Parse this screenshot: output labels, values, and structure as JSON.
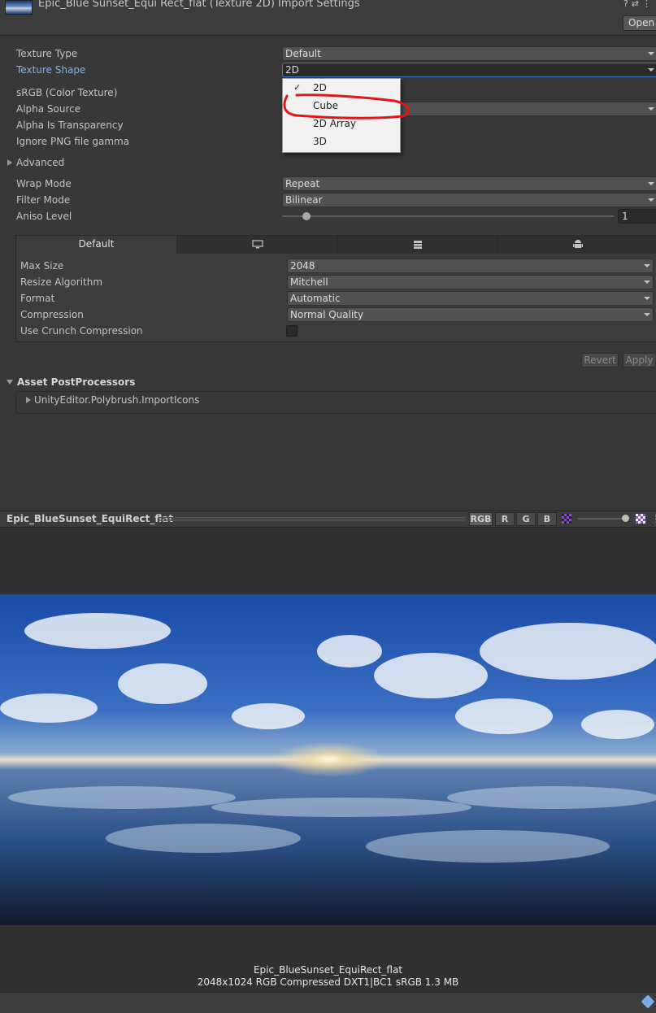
{
  "header": {
    "title": "Epic_Blue Sunset_Equi Rect_flat (Texture 2D) Import Settings",
    "open_label": "Open",
    "icons": [
      "help-icon",
      "preset-icon",
      "menu-icon"
    ]
  },
  "fields": {
    "texture_type": {
      "label": "Texture Type",
      "value": "Default"
    },
    "texture_shape": {
      "label": "Texture Shape",
      "value": "2D"
    },
    "srgb": {
      "label": "sRGB (Color Texture)"
    },
    "alpha_source": {
      "label": "Alpha Source"
    },
    "alpha_transparency": {
      "label": "Alpha Is Transparency"
    },
    "ignore_png_gamma": {
      "label": "Ignore PNG file gamma"
    },
    "advanced": {
      "label": "Advanced"
    },
    "wrap_mode": {
      "label": "Wrap Mode",
      "value": "Repeat"
    },
    "filter_mode": {
      "label": "Filter Mode",
      "value": "Bilinear"
    },
    "aniso_level": {
      "label": "Aniso Level",
      "value": "1"
    }
  },
  "shape_menu": {
    "options": [
      "2D",
      "Cube",
      "2D Array",
      "3D"
    ],
    "selected": "2D",
    "annotated": "Cube",
    "annotation_color": "#e0161b"
  },
  "platforms": {
    "tabs": [
      {
        "label": "Default",
        "icon": ""
      },
      {
        "label": "",
        "icon": "monitor-icon"
      },
      {
        "label": "",
        "icon": "server-icon"
      },
      {
        "label": "",
        "icon": "android-icon"
      }
    ],
    "max_size": {
      "label": "Max Size",
      "value": "2048"
    },
    "resize_algorithm": {
      "label": "Resize Algorithm",
      "value": "Mitchell"
    },
    "format": {
      "label": "Format",
      "value": "Automatic"
    },
    "compression": {
      "label": "Compression",
      "value": "Normal Quality"
    },
    "crunch": {
      "label": "Use Crunch Compression"
    }
  },
  "actions": {
    "revert": "Revert",
    "apply": "Apply"
  },
  "postprocessors": {
    "title": "Asset PostProcessors",
    "item": "UnityEditor.Polybrush.ImportIcons"
  },
  "preview": {
    "name": "Epic_BlueSunset_EquiRect_flat",
    "channels": [
      "RGB",
      "R",
      "G",
      "B"
    ],
    "info_name": "Epic_BlueSunset_EquiRect_flat",
    "info_details": "2048x1024  RGB Compressed DXT1|BC1 sRGB   1.3 MB"
  },
  "colors": {
    "panel": "#383838",
    "highlight_label": "#7cb5f0",
    "focus_border": "#3a78c8"
  }
}
